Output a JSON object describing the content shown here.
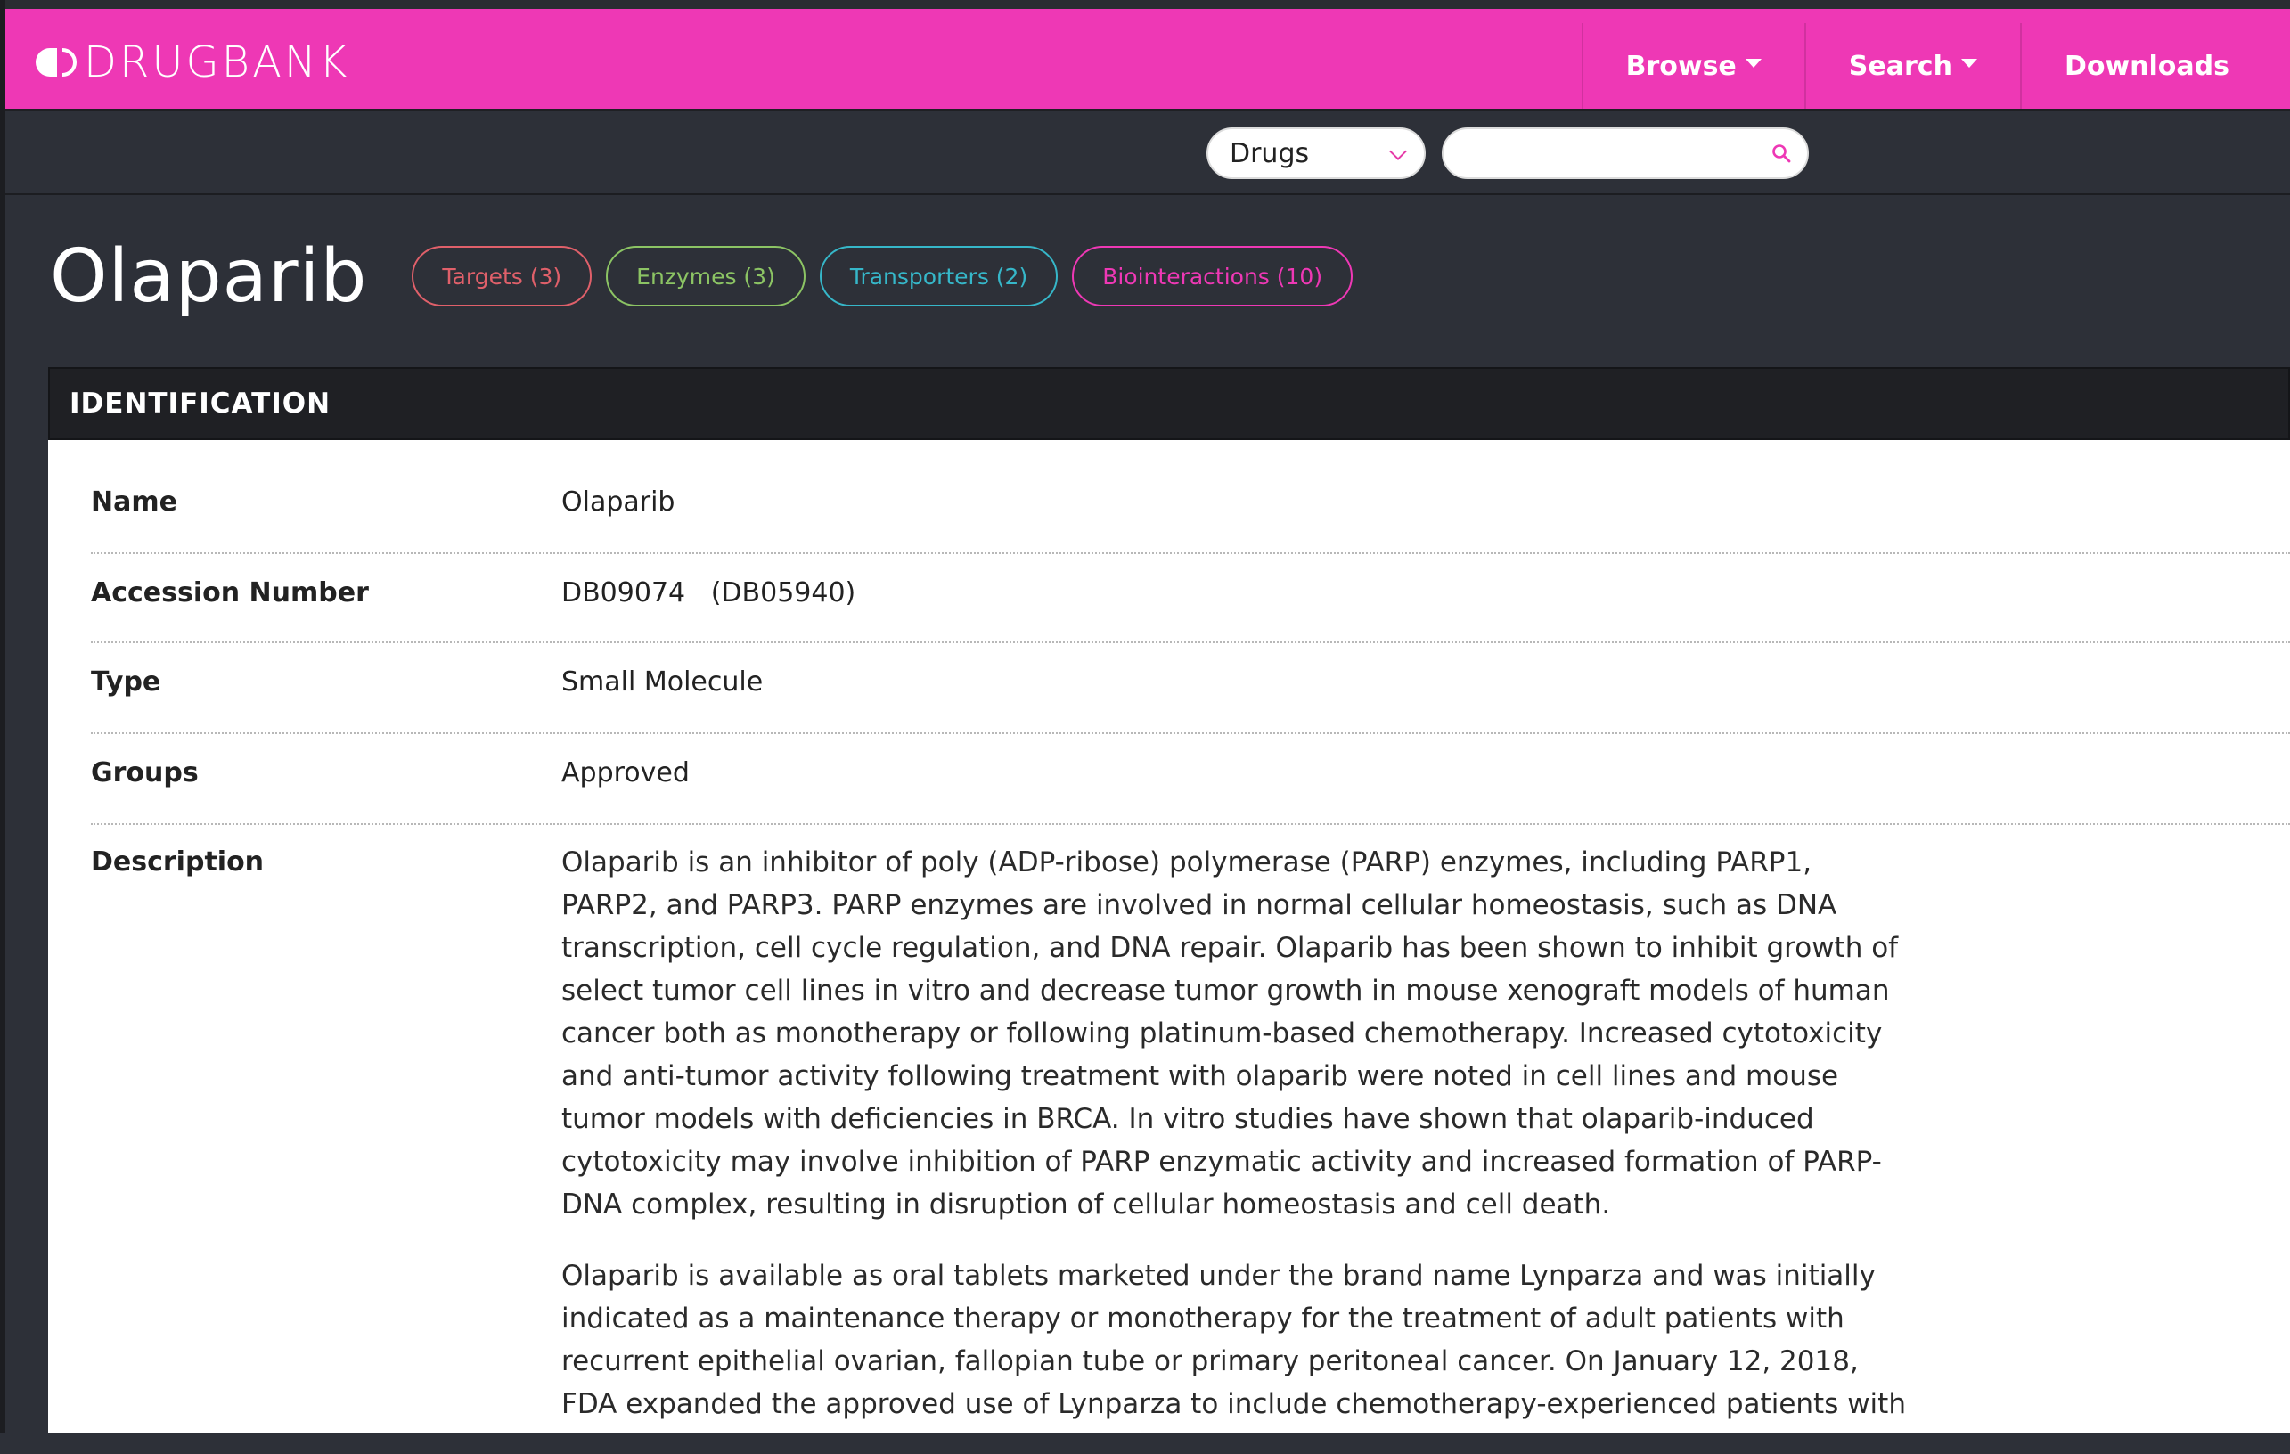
{
  "brand": {
    "logo_text": "DRUGBANK",
    "accent": "#ee38b5"
  },
  "nav": {
    "browse_label": "Browse",
    "search_label": "Search",
    "downloads_label": "Downloads"
  },
  "search": {
    "category_selected": "Drugs",
    "query_value": "",
    "placeholder": ""
  },
  "drug": {
    "title": "Olaparib",
    "pills": [
      {
        "label": "Targets (3)",
        "color": "#e0606a"
      },
      {
        "label": "Enzymes (3)",
        "color": "#8cc464"
      },
      {
        "label": "Transporters (2)",
        "color": "#36b7c9"
      },
      {
        "label": "Biointeractions (10)",
        "color": "#ee38b5"
      }
    ]
  },
  "identification": {
    "section_title": "IDENTIFICATION",
    "rows": [
      {
        "label": "Name",
        "value": "Olaparib"
      },
      {
        "label": "Accession Number",
        "value": "DB09074   (DB05940)"
      },
      {
        "label": "Type",
        "value": "Small Molecule"
      },
      {
        "label": "Groups",
        "value": "Approved"
      }
    ],
    "description_label": "Description",
    "description": [
      "Olaparib is an inhibitor of poly (ADP-ribose) polymerase (PARP) enzymes, including PARP1, PARP2, and PARP3. PARP enzymes are involved in normal cellular homeostasis, such as DNA transcription, cell cycle regulation, and DNA repair. Olaparib has been shown to inhibit growth of select tumor cell lines in vitro and decrease tumor growth in mouse xenograft models of human cancer both as monotherapy or following platinum-based chemotherapy. Increased cytotoxicity and anti-tumor activity following treatment with olaparib were noted in cell lines and mouse tumor models with deficiencies in BRCA. In vitro studies have shown that olaparib-induced cytotoxicity may involve inhibition of PARP enzymatic activity and increased formation of PARP-DNA complex, resulting in disruption of cellular homeostasis and cell death.",
      "Olaparib is available as oral tablets marketed under the brand name Lynparza and was initially indicated as a maintenance therapy or monotherapy for the treatment of adult patients with recurrent epithelial ovarian, fallopian tube or primary peritoneal cancer. On January 12, 2018, FDA expanded the approved use of Lynparza to include chemotherapy-experienced patients with"
    ]
  }
}
